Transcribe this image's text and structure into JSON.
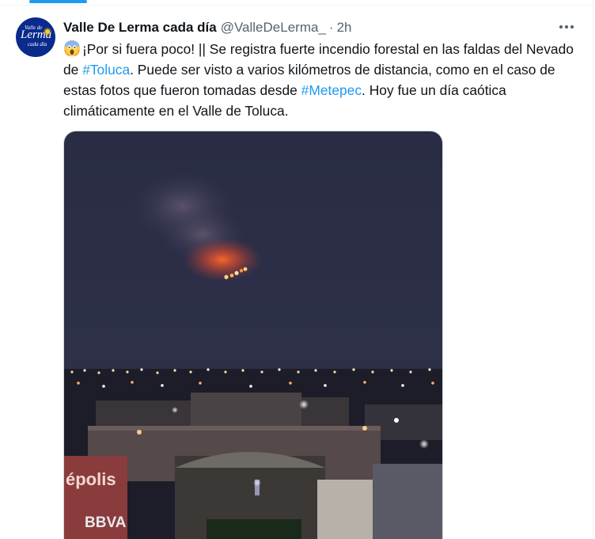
{
  "tweet": {
    "avatar": {
      "line1": "Valle de",
      "line2": "Lerma",
      "line3": "cada día"
    },
    "display_name": "Valle De Lerma cada día",
    "handle": "@ValleDeLerma_",
    "separator": "·",
    "time": "2h",
    "more_icon": "more-horizontal-icon",
    "text": {
      "emoji": "screaming-face-emoji",
      "part1": "¡Por si fuera poco! || Se registra fuerte incendio forestal en las faldas del Nevado de ",
      "hashtag1": "#Toluca",
      "part2": ". Puede ser visto a varios kilómetros de distancia, como en el caso de estas fotos que fueron tomadas desde ",
      "hashtag2": "#Metepec",
      "part3": ". Hoy fue un día caótica climáticamente en el Valle de Toluca."
    },
    "media": {
      "sign_left": "épolis",
      "sign_bank": "BBVA"
    }
  },
  "colors": {
    "accent": "#1d9bf0",
    "text": "#0f1419",
    "muted": "#536471",
    "fire": "#ff5a1e"
  }
}
